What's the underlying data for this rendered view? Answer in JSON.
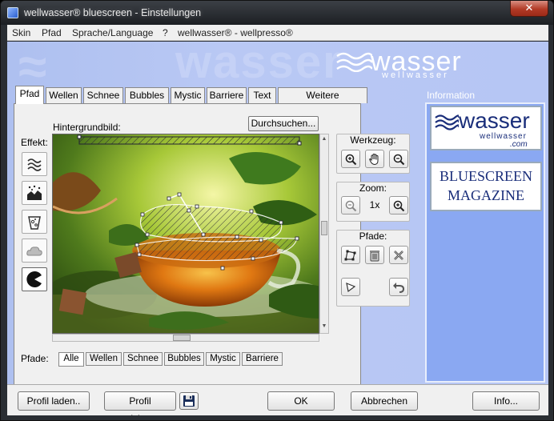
{
  "window": {
    "title": "wellwasser® bluescreen - Einstellungen",
    "close_glyph": "✕"
  },
  "menu": [
    "Skin",
    "Pfad",
    "Sprache/Language",
    "?",
    "wellwasser® - wellpresso®"
  ],
  "header": {
    "logo_word": "wasser",
    "logo_sub": "wellwasser"
  },
  "tabs": [
    "Pfad",
    "Wellen",
    "Schnee",
    "Bubbles",
    "Mystic",
    "Barriere",
    "Text",
    "Weitere Einstellungen"
  ],
  "active_tab": "Pfad",
  "pfad": {
    "effekt_label": "Effekt:",
    "hintergrund_label": "Hintergrundbild:",
    "browse_label": "Durchsuchen...",
    "werkzeug_label": "Werkzeug:",
    "zoom_label": "Zoom:",
    "zoom_value": "1x",
    "pfade_group_label": "Pfade:",
    "pfade_label": "Pfade:",
    "path_tabs": [
      "Alle",
      "Wellen",
      "Schnee",
      "Bubbles",
      "Mystic",
      "Barriere"
    ],
    "active_path_tab": "Alle"
  },
  "info": {
    "label": "Information",
    "ad1_word": "wasser",
    "ad1_sub": "wellwasser",
    "ad1_com": ".com",
    "ad2_line1": "BLUESCREEN",
    "ad2_line2": "MAGAZINE"
  },
  "buttons": {
    "load_profile": "Profil laden..",
    "save_profile": "Profil speichern...",
    "ok": "OK",
    "cancel": "Abbrechen",
    "info": "Info..."
  },
  "colors": {
    "accent": "#b6c6f4",
    "close": "#b23a26",
    "info_panel": "#8aa8f2"
  }
}
